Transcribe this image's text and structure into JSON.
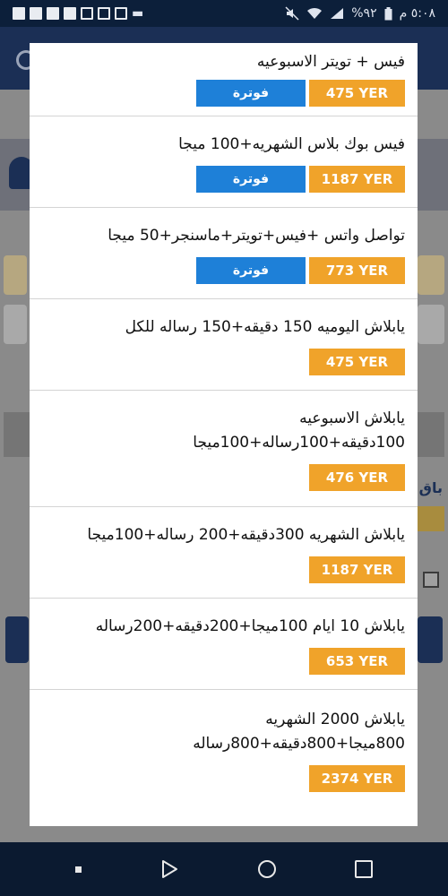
{
  "status_bar": {
    "time": "٥:٠٨ م",
    "battery": "%٩٢"
  },
  "packages": [
    {
      "title": "فيس + تويتر الاسبوعيه",
      "price": "475 YER",
      "invoice_label": "فوترة"
    },
    {
      "title": "فيس بوك بلاس الشهريه+100 ميجا",
      "price": "1187 YER",
      "invoice_label": "فوترة"
    },
    {
      "title": "تواصل واتس +فيس+تويتر+ماسنجر+50 ميجا",
      "price": "773 YER",
      "invoice_label": "فوترة"
    },
    {
      "title": "يابلاش اليوميه 150 دقيقه+150 رساله للكل",
      "price": "475 YER"
    },
    {
      "title": "يابلاش الاسبوعيه\n100دقيقه+100رساله+100ميجا",
      "price": "476 YER"
    },
    {
      "title": "يابلاش الشهريه 300دقيقه+200 رساله+100ميجا",
      "price": "1187 YER"
    },
    {
      "title": "يابلاش 10 ايام 100ميجا+200دقيقه+200رساله",
      "price": "653 YER"
    },
    {
      "title": "يابلاش 2000 الشهريه\n800ميجا+800دقيقه+800رساله",
      "price": "2374 YER"
    }
  ],
  "background": {
    "partial_label": "باق"
  },
  "icons": {
    "sync": "sync-icon",
    "mute": "mute-icon",
    "wifi": "wifi-icon",
    "signal": "signal-icon",
    "battery": "battery-icon",
    "nav_back": "back-triangle-icon",
    "nav_home": "home-circle-icon",
    "nav_recent": "recent-square-icon"
  }
}
